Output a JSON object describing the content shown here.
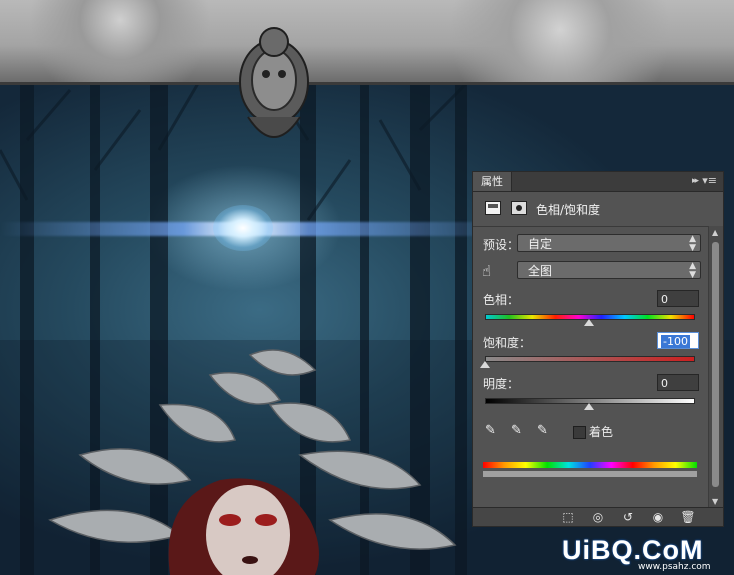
{
  "panel": {
    "tab_label": "属性",
    "collapse_glyph": "▸▸",
    "menu_glyph": "▾≡",
    "title": "色相/饱和度",
    "preset_label": "预设：",
    "preset_value": "自定",
    "channel_value": "全图",
    "hue": {
      "label": "色相：",
      "value": "0",
      "fraction": 0.5
    },
    "saturation": {
      "label": "饱和度：",
      "value": "-100",
      "fraction": 0.0
    },
    "lightness": {
      "label": "明度：",
      "value": "0",
      "fraction": 0.5
    },
    "colorize_label": "着色",
    "colorize_checked": false
  },
  "watermark": {
    "text": "UiBQ.CoM",
    "sub": "www.psahz.com"
  },
  "icons": {
    "layer": "adjustment-layer-icon",
    "mask": "mask-icon",
    "hand": "targeted-adjustment-hand-icon",
    "eyedroppers": [
      "eyedropper-icon",
      "eyedropper-add-icon",
      "eyedropper-subtract-icon"
    ],
    "footer": [
      "clip-to-layer-icon",
      "view-previous-icon",
      "reset-icon",
      "visibility-eye-icon",
      "trash-icon"
    ]
  }
}
